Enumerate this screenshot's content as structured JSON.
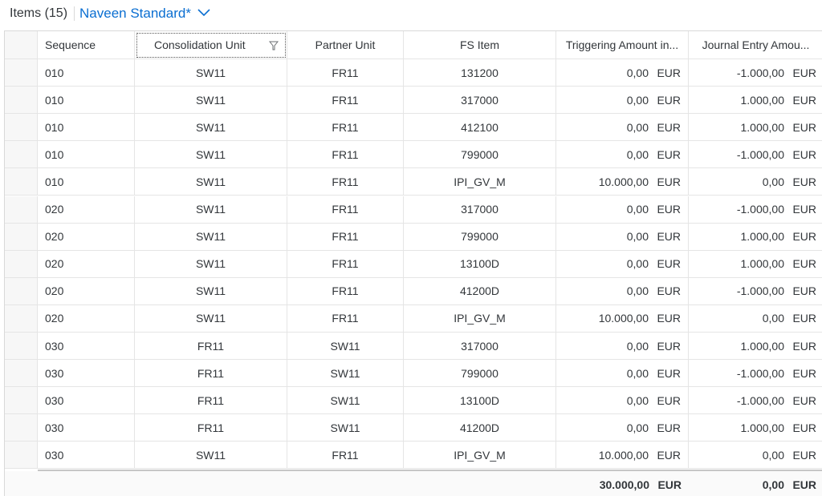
{
  "header": {
    "title": "Items (15)",
    "variant_name": "Naveen Standard*"
  },
  "columns": [
    {
      "key": "sequence",
      "label": "Sequence"
    },
    {
      "key": "consolidation_unit",
      "label": "Consolidation Unit"
    },
    {
      "key": "partner_unit",
      "label": "Partner Unit"
    },
    {
      "key": "fs_item",
      "label": "FS Item"
    },
    {
      "key": "triggering_amount",
      "label": "Triggering Amount in..."
    },
    {
      "key": "journal_entry_amount",
      "label": "Journal Entry Amou..."
    }
  ],
  "rows": [
    {
      "seq": "010",
      "cu": "SW11",
      "pu": "FR11",
      "fs": "131200",
      "ta": "0,00",
      "ta_cur": "EUR",
      "je": "-1.000,00",
      "je_cur": "EUR"
    },
    {
      "seq": "010",
      "cu": "SW11",
      "pu": "FR11",
      "fs": "317000",
      "ta": "0,00",
      "ta_cur": "EUR",
      "je": "1.000,00",
      "je_cur": "EUR"
    },
    {
      "seq": "010",
      "cu": "SW11",
      "pu": "FR11",
      "fs": "412100",
      "ta": "0,00",
      "ta_cur": "EUR",
      "je": "1.000,00",
      "je_cur": "EUR"
    },
    {
      "seq": "010",
      "cu": "SW11",
      "pu": "FR11",
      "fs": "799000",
      "ta": "0,00",
      "ta_cur": "EUR",
      "je": "-1.000,00",
      "je_cur": "EUR"
    },
    {
      "seq": "010",
      "cu": "SW11",
      "pu": "FR11",
      "fs": "IPI_GV_M",
      "ta": "10.000,00",
      "ta_cur": "EUR",
      "je": "0,00",
      "je_cur": "EUR"
    },
    {
      "seq": "020",
      "cu": "SW11",
      "pu": "FR11",
      "fs": "317000",
      "ta": "0,00",
      "ta_cur": "EUR",
      "je": "-1.000,00",
      "je_cur": "EUR"
    },
    {
      "seq": "020",
      "cu": "SW11",
      "pu": "FR11",
      "fs": "799000",
      "ta": "0,00",
      "ta_cur": "EUR",
      "je": "1.000,00",
      "je_cur": "EUR"
    },
    {
      "seq": "020",
      "cu": "SW11",
      "pu": "FR11",
      "fs": "13100D",
      "ta": "0,00",
      "ta_cur": "EUR",
      "je": "1.000,00",
      "je_cur": "EUR"
    },
    {
      "seq": "020",
      "cu": "SW11",
      "pu": "FR11",
      "fs": "41200D",
      "ta": "0,00",
      "ta_cur": "EUR",
      "je": "-1.000,00",
      "je_cur": "EUR"
    },
    {
      "seq": "020",
      "cu": "SW11",
      "pu": "FR11",
      "fs": "IPI_GV_M",
      "ta": "10.000,00",
      "ta_cur": "EUR",
      "je": "0,00",
      "je_cur": "EUR"
    },
    {
      "seq": "030",
      "cu": "FR11",
      "pu": "SW11",
      "fs": "317000",
      "ta": "0,00",
      "ta_cur": "EUR",
      "je": "1.000,00",
      "je_cur": "EUR"
    },
    {
      "seq": "030",
      "cu": "FR11",
      "pu": "SW11",
      "fs": "799000",
      "ta": "0,00",
      "ta_cur": "EUR",
      "je": "-1.000,00",
      "je_cur": "EUR"
    },
    {
      "seq": "030",
      "cu": "FR11",
      "pu": "SW11",
      "fs": "13100D",
      "ta": "0,00",
      "ta_cur": "EUR",
      "je": "-1.000,00",
      "je_cur": "EUR"
    },
    {
      "seq": "030",
      "cu": "FR11",
      "pu": "SW11",
      "fs": "41200D",
      "ta": "0,00",
      "ta_cur": "EUR",
      "je": "1.000,00",
      "je_cur": "EUR"
    },
    {
      "seq": "030",
      "cu": "SW11",
      "pu": "FR11",
      "fs": "IPI_GV_M",
      "ta": "10.000,00",
      "ta_cur": "EUR",
      "je": "0,00",
      "je_cur": "EUR"
    }
  ],
  "totals": {
    "ta": "30.000,00",
    "ta_cur": "EUR",
    "je": "0,00",
    "je_cur": "EUR"
  },
  "icons": {
    "chevron": "chevron-down-icon",
    "filter": "filter-icon"
  },
  "colors": {
    "link": "#0a6ed1",
    "text": "#32363a"
  }
}
